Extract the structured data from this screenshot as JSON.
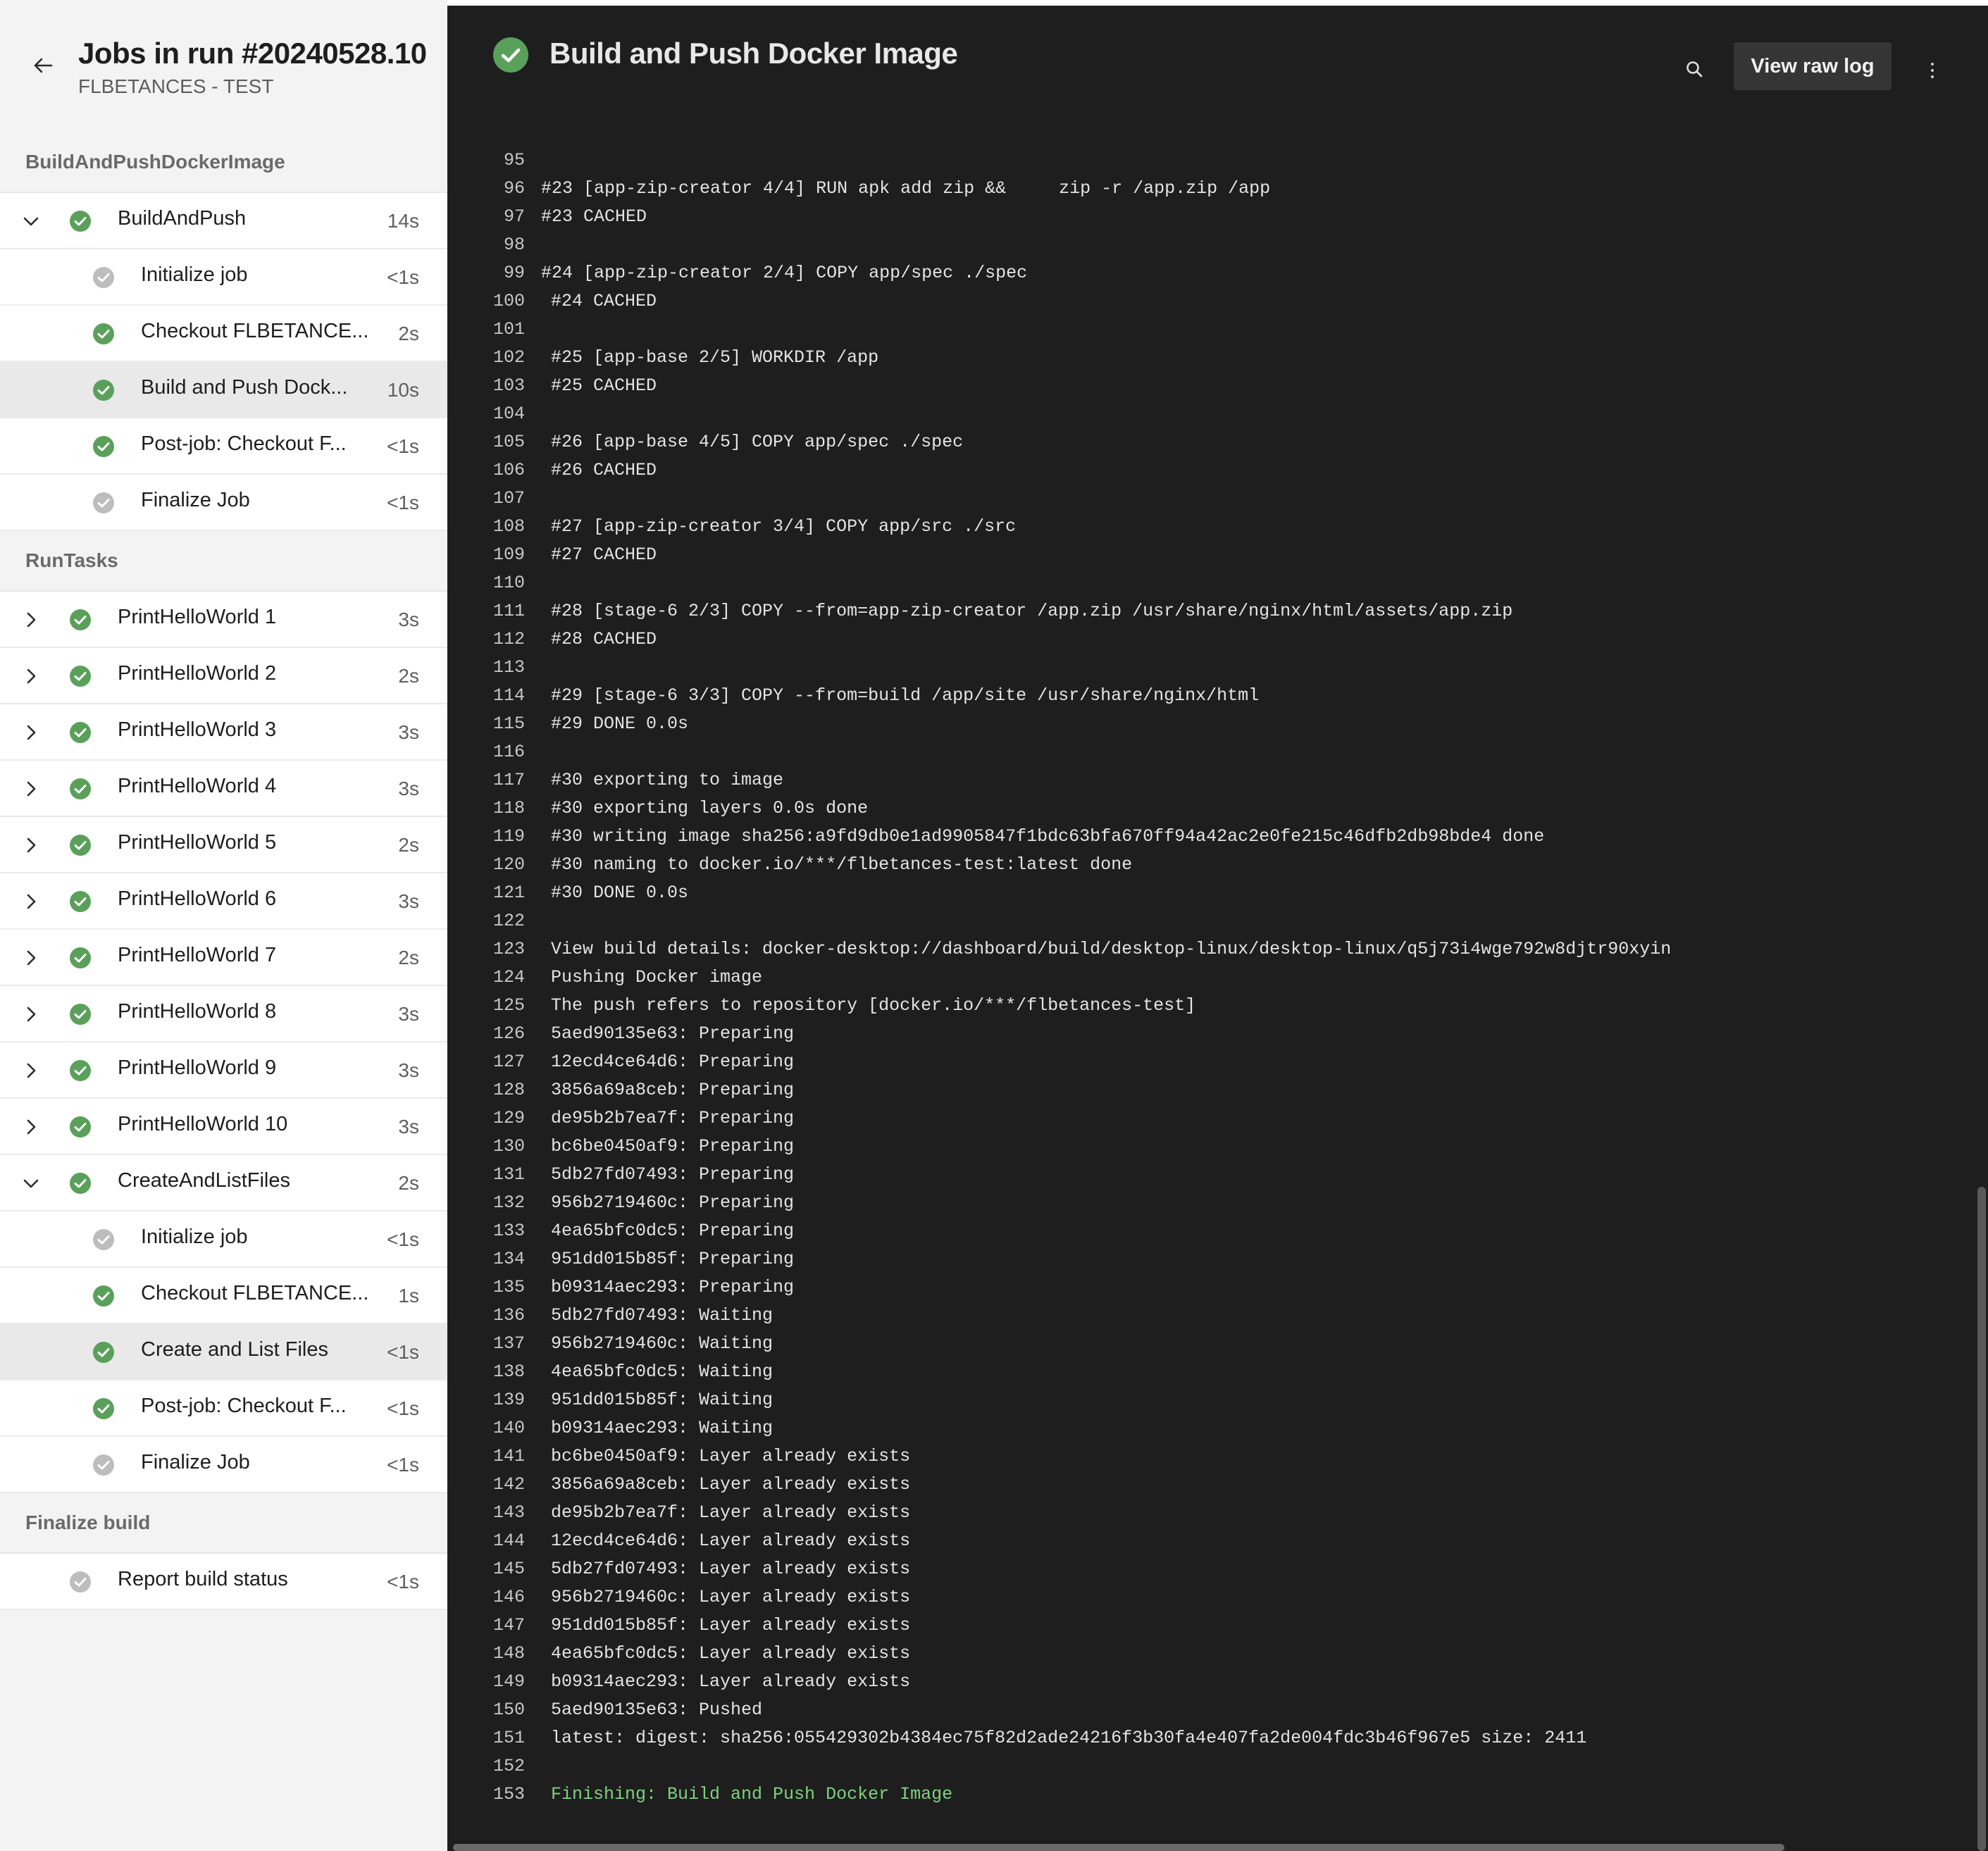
{
  "run": {
    "title": "Jobs in run #20240528.10",
    "subtitle": "FLBETANCES - TEST"
  },
  "colors": {
    "success": "#5aa05a",
    "skipped": "#bdbdbd",
    "log_bg": "#1e1e1e",
    "finishing_text": "#7ed27e"
  },
  "tree": {
    "stage1": "BuildAndPushDockerImage",
    "stage2": "RunTasks",
    "stage3": "Finalize build",
    "build_job": {
      "label": "BuildAndPush",
      "dur": "14s",
      "status": "success"
    },
    "build_steps": [
      {
        "label": "Initialize job",
        "dur": "<1s",
        "status": "skipped"
      },
      {
        "label": "Checkout FLBETANCE...",
        "dur": "2s",
        "status": "success"
      },
      {
        "label": "Build and Push Dock...",
        "dur": "10s",
        "status": "success"
      },
      {
        "label": "Post-job: Checkout F...",
        "dur": "<1s",
        "status": "success"
      },
      {
        "label": "Finalize Job",
        "dur": "<1s",
        "status": "skipped"
      }
    ],
    "tasks": [
      {
        "label": "PrintHelloWorld 1",
        "dur": "3s"
      },
      {
        "label": "PrintHelloWorld 2",
        "dur": "2s"
      },
      {
        "label": "PrintHelloWorld 3",
        "dur": "3s"
      },
      {
        "label": "PrintHelloWorld 4",
        "dur": "3s"
      },
      {
        "label": "PrintHelloWorld 5",
        "dur": "2s"
      },
      {
        "label": "PrintHelloWorld 6",
        "dur": "3s"
      },
      {
        "label": "PrintHelloWorld 7",
        "dur": "2s"
      },
      {
        "label": "PrintHelloWorld 8",
        "dur": "3s"
      },
      {
        "label": "PrintHelloWorld 9",
        "dur": "3s"
      },
      {
        "label": "PrintHelloWorld 10",
        "dur": "3s"
      }
    ],
    "files_job": {
      "label": "CreateAndListFiles",
      "dur": "2s",
      "status": "success"
    },
    "files_steps": [
      {
        "label": "Initialize job",
        "dur": "<1s",
        "status": "skipped"
      },
      {
        "label": "Checkout FLBETANCE...",
        "dur": "1s",
        "status": "success"
      },
      {
        "label": "Create and List Files",
        "dur": "<1s",
        "status": "success"
      },
      {
        "label": "Post-job: Checkout F...",
        "dur": "<1s",
        "status": "success"
      },
      {
        "label": "Finalize Job",
        "dur": "<1s",
        "status": "skipped"
      }
    ],
    "report": {
      "label": "Report build status",
      "dur": "<1s",
      "status": "skipped"
    }
  },
  "log": {
    "title": "Build and Push Docker Image",
    "raw_button": "View raw log",
    "lines": [
      {
        "n": "95",
        "t": ""
      },
      {
        "n": "96",
        "t": "#23 [app-zip-creator 4/4] RUN apk add zip &&     zip -r /app.zip /app"
      },
      {
        "n": "97",
        "t": "#23 CACHED"
      },
      {
        "n": "98",
        "t": ""
      },
      {
        "n": "99",
        "t": "#24 [app-zip-creator 2/4] COPY app/spec ./spec"
      },
      {
        "n": "100",
        "t": "#24 CACHED"
      },
      {
        "n": "101",
        "t": ""
      },
      {
        "n": "102",
        "t": "#25 [app-base 2/5] WORKDIR /app"
      },
      {
        "n": "103",
        "t": "#25 CACHED"
      },
      {
        "n": "104",
        "t": ""
      },
      {
        "n": "105",
        "t": "#26 [app-base 4/5] COPY app/spec ./spec"
      },
      {
        "n": "106",
        "t": "#26 CACHED"
      },
      {
        "n": "107",
        "t": ""
      },
      {
        "n": "108",
        "t": "#27 [app-zip-creator 3/4] COPY app/src ./src"
      },
      {
        "n": "109",
        "t": "#27 CACHED"
      },
      {
        "n": "110",
        "t": ""
      },
      {
        "n": "111",
        "t": "#28 [stage-6 2/3] COPY --from=app-zip-creator /app.zip /usr/share/nginx/html/assets/app.zip"
      },
      {
        "n": "112",
        "t": "#28 CACHED"
      },
      {
        "n": "113",
        "t": ""
      },
      {
        "n": "114",
        "t": "#29 [stage-6 3/3] COPY --from=build /app/site /usr/share/nginx/html"
      },
      {
        "n": "115",
        "t": "#29 DONE 0.0s"
      },
      {
        "n": "116",
        "t": ""
      },
      {
        "n": "117",
        "t": "#30 exporting to image"
      },
      {
        "n": "118",
        "t": "#30 exporting layers 0.0s done"
      },
      {
        "n": "119",
        "t": "#30 writing image sha256:a9fd9db0e1ad9905847f1bdc63bfa670ff94a42ac2e0fe215c46dfb2db98bde4 done"
      },
      {
        "n": "120",
        "t": "#30 naming to docker.io/***/flbetances-test:latest done"
      },
      {
        "n": "121",
        "t": "#30 DONE 0.0s"
      },
      {
        "n": "122",
        "t": ""
      },
      {
        "n": "123",
        "t": "View build details: docker-desktop://dashboard/build/desktop-linux/desktop-linux/q5j73i4wge792w8djtr90xyin"
      },
      {
        "n": "124",
        "t": "Pushing Docker image"
      },
      {
        "n": "125",
        "t": "The push refers to repository [docker.io/***/flbetances-test]"
      },
      {
        "n": "126",
        "t": "5aed90135e63: Preparing"
      },
      {
        "n": "127",
        "t": "12ecd4ce64d6: Preparing"
      },
      {
        "n": "128",
        "t": "3856a69a8ceb: Preparing"
      },
      {
        "n": "129",
        "t": "de95b2b7ea7f: Preparing"
      },
      {
        "n": "130",
        "t": "bc6be0450af9: Preparing"
      },
      {
        "n": "131",
        "t": "5db27fd07493: Preparing"
      },
      {
        "n": "132",
        "t": "956b2719460c: Preparing"
      },
      {
        "n": "133",
        "t": "4ea65bfc0dc5: Preparing"
      },
      {
        "n": "134",
        "t": "951dd015b85f: Preparing"
      },
      {
        "n": "135",
        "t": "b09314aec293: Preparing"
      },
      {
        "n": "136",
        "t": "5db27fd07493: Waiting"
      },
      {
        "n": "137",
        "t": "956b2719460c: Waiting"
      },
      {
        "n": "138",
        "t": "4ea65bfc0dc5: Waiting"
      },
      {
        "n": "139",
        "t": "951dd015b85f: Waiting"
      },
      {
        "n": "140",
        "t": "b09314aec293: Waiting"
      },
      {
        "n": "141",
        "t": "bc6be0450af9: Layer already exists"
      },
      {
        "n": "142",
        "t": "3856a69a8ceb: Layer already exists"
      },
      {
        "n": "143",
        "t": "de95b2b7ea7f: Layer already exists"
      },
      {
        "n": "144",
        "t": "12ecd4ce64d6: Layer already exists"
      },
      {
        "n": "145",
        "t": "5db27fd07493: Layer already exists"
      },
      {
        "n": "146",
        "t": "956b2719460c: Layer already exists"
      },
      {
        "n": "147",
        "t": "951dd015b85f: Layer already exists"
      },
      {
        "n": "148",
        "t": "4ea65bfc0dc5: Layer already exists"
      },
      {
        "n": "149",
        "t": "b09314aec293: Layer already exists"
      },
      {
        "n": "150",
        "t": "5aed90135e63: Pushed"
      },
      {
        "n": "151",
        "t": "latest: digest: sha256:055429302b4384ec75f82d2ade24216f3b30fa4e407fa2de004fdc3b46f967e5 size: 2411"
      },
      {
        "n": "152",
        "t": ""
      },
      {
        "n": "153",
        "t": "Finishing: Build and Push Docker Image"
      }
    ]
  }
}
